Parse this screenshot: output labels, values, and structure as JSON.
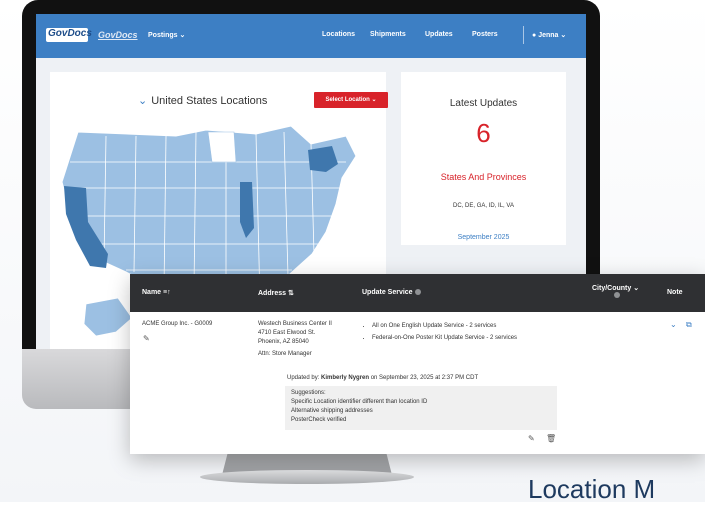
{
  "nav": {
    "logo": "GovDocs",
    "brand_secondary": "GovDocs",
    "postings": "Postings ⌄",
    "locations": "Locations",
    "shipments": "Shipments",
    "updates": "Updates",
    "posters": "Posters",
    "user": "Jenna ⌄"
  },
  "map_card": {
    "title": "United States Locations",
    "select_button": "Select Location ⌄",
    "highlight_color": "#3f77ad",
    "base_color": "#9cc0e3"
  },
  "updates_card": {
    "title": "Latest Updates",
    "count": "6",
    "subtitle": "States And Provinces",
    "states": "DC, DE, GA, ID, IL, VA",
    "date": "September 2025"
  },
  "table": {
    "headers": {
      "name": "Name ≡↑",
      "address": "Address ⇅",
      "update_service": "Update Service",
      "city_county": "City/County ⌄",
      "note": "Note"
    },
    "row": {
      "name": "ACME Group Inc. - G0009",
      "address_lines": [
        "Westech Business Center II",
        "4710 East Elwood St.",
        "Phoenix, AZ 85040"
      ],
      "attn": "Attn: Store Manager",
      "services": [
        "All on One English Update Service - 2 services",
        "Federal-on-One Poster Kit Update Service - 2 services"
      ],
      "updated_prefix": "Updated by: ",
      "updated_name": "Kimberly Nygren",
      "updated_suffix": " on September 23, 2025 at 2:37 PM CDT",
      "suggestions": [
        "Suggestions:",
        "Specific Location identifier different than location ID",
        "Alternative shipping addresses",
        "PosterCheck verified"
      ]
    }
  },
  "bottom_heading": "Location M"
}
